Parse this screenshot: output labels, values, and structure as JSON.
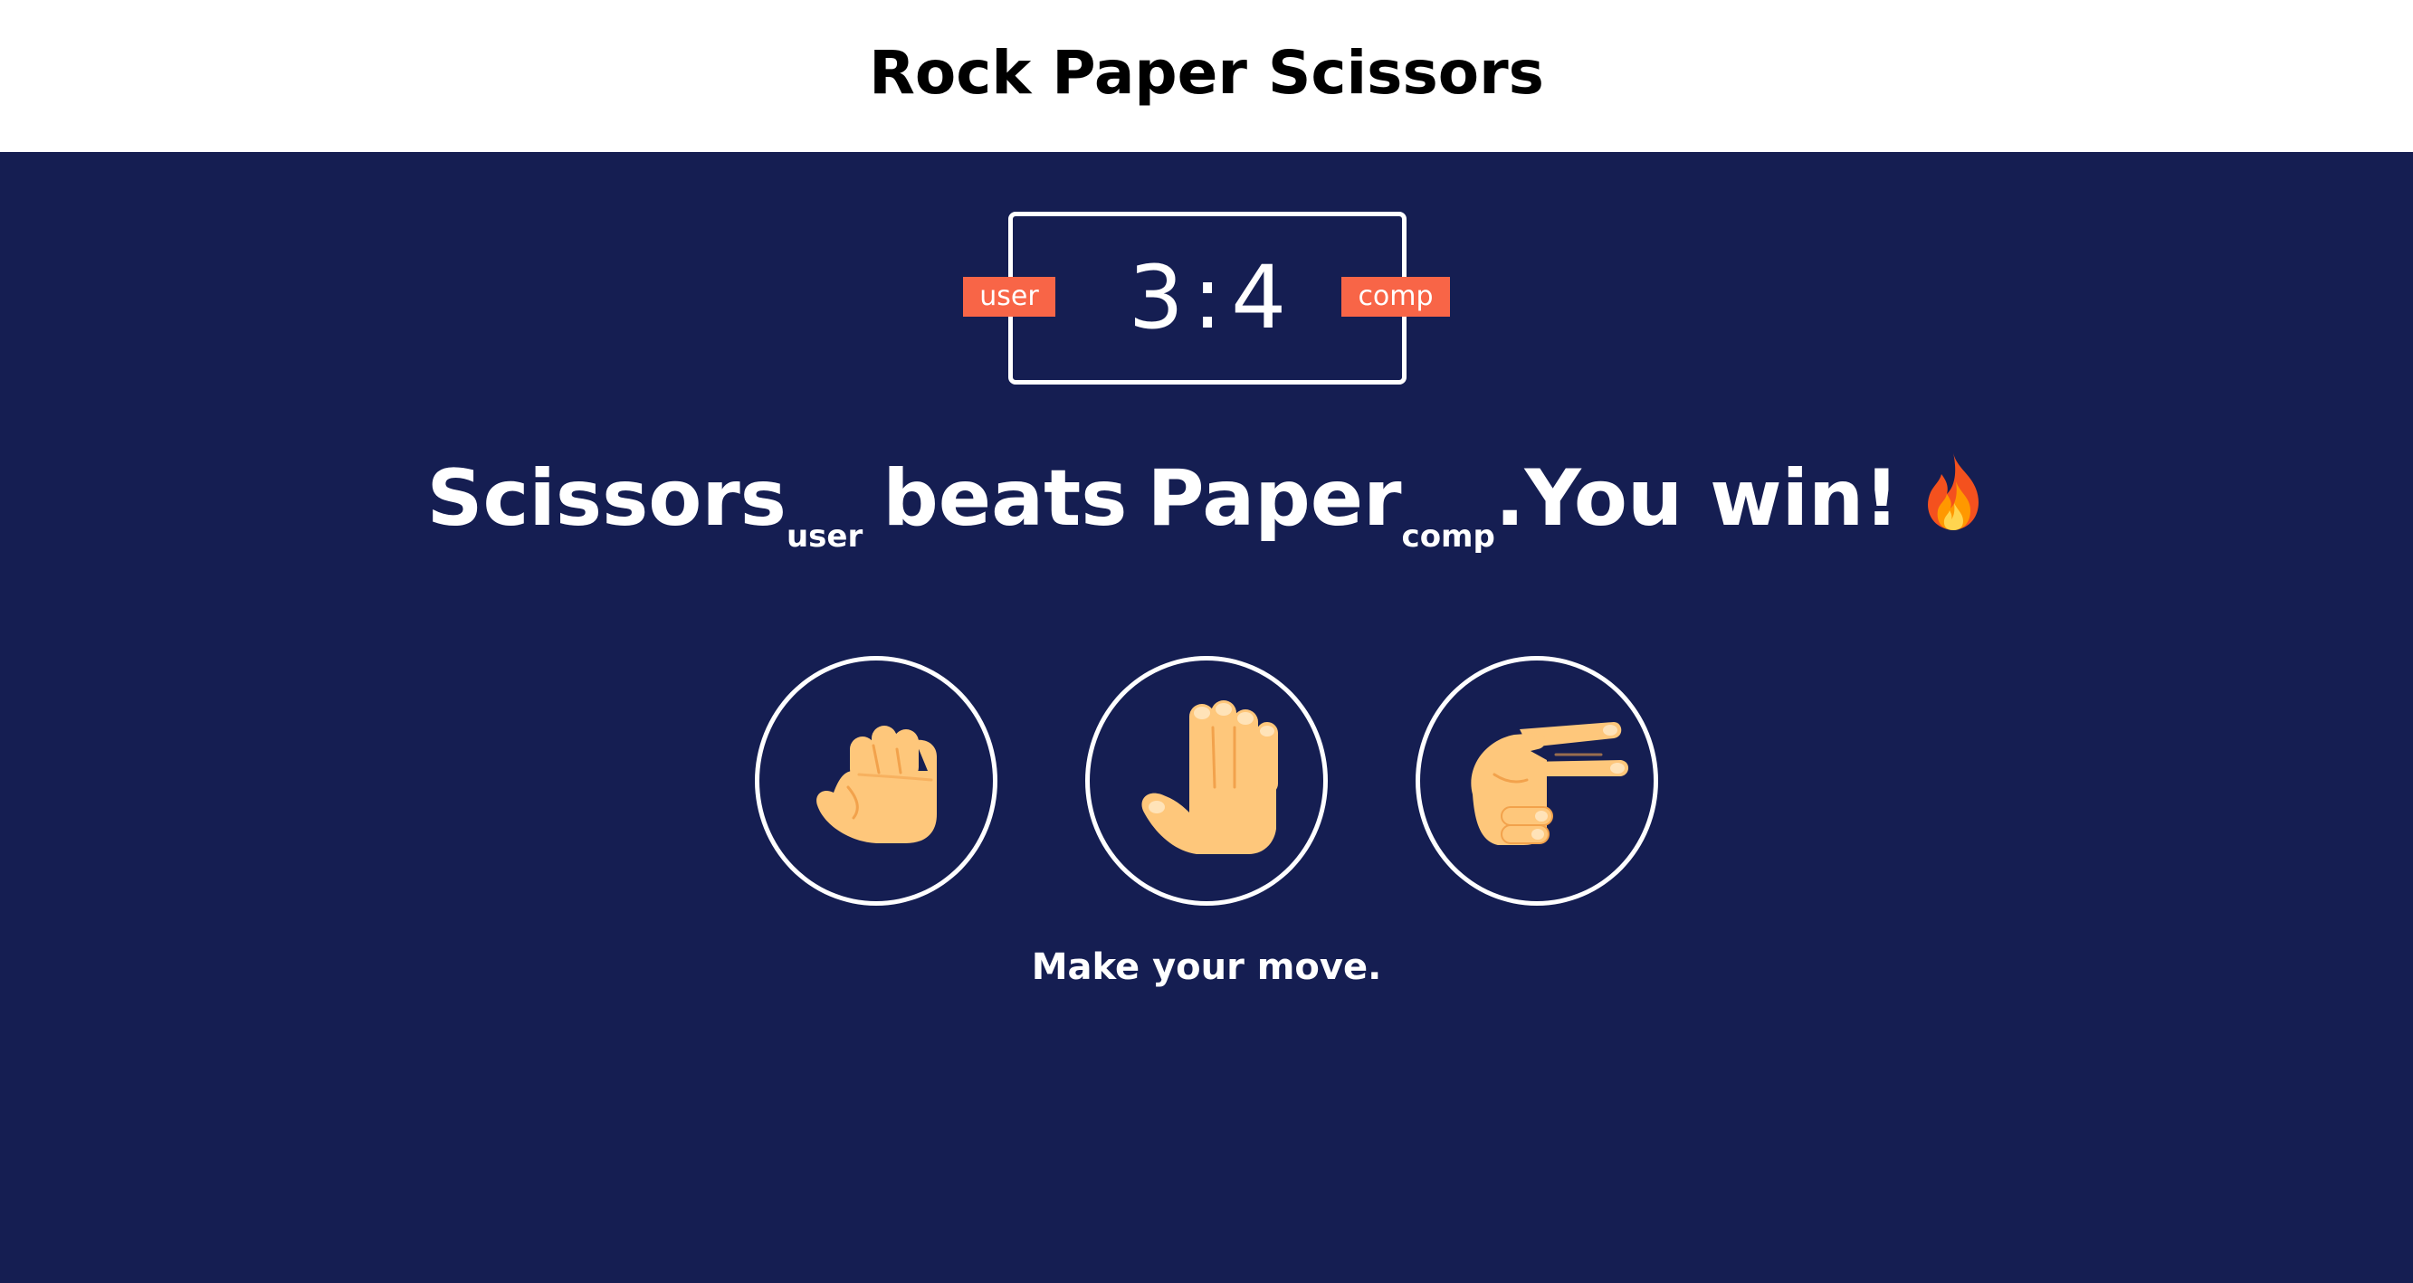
{
  "header": {
    "title": "Rock Paper Scissors"
  },
  "scoreboard": {
    "user_score": "3",
    "separator": ":",
    "comp_score": "4",
    "user_badge": "user",
    "comp_badge": "comp"
  },
  "result": {
    "user_choice": "Scissors",
    "user_sub": "user",
    "verb": "beats",
    "comp_choice": "Paper",
    "comp_sub": "comp",
    "message": ".You win!",
    "emoji_icon": "fire-icon"
  },
  "choices": [
    {
      "name": "rock",
      "icon": "rock-hand-icon"
    },
    {
      "name": "paper",
      "icon": "paper-hand-icon"
    },
    {
      "name": "scissors",
      "icon": "scissors-hand-icon"
    }
  ],
  "prompt": "Make your move.",
  "colors": {
    "background": "#151e52",
    "header": "#ffffff",
    "badge": "#f86547",
    "hand_skin": "#fec77b",
    "hand_shade": "#f2a24c"
  }
}
